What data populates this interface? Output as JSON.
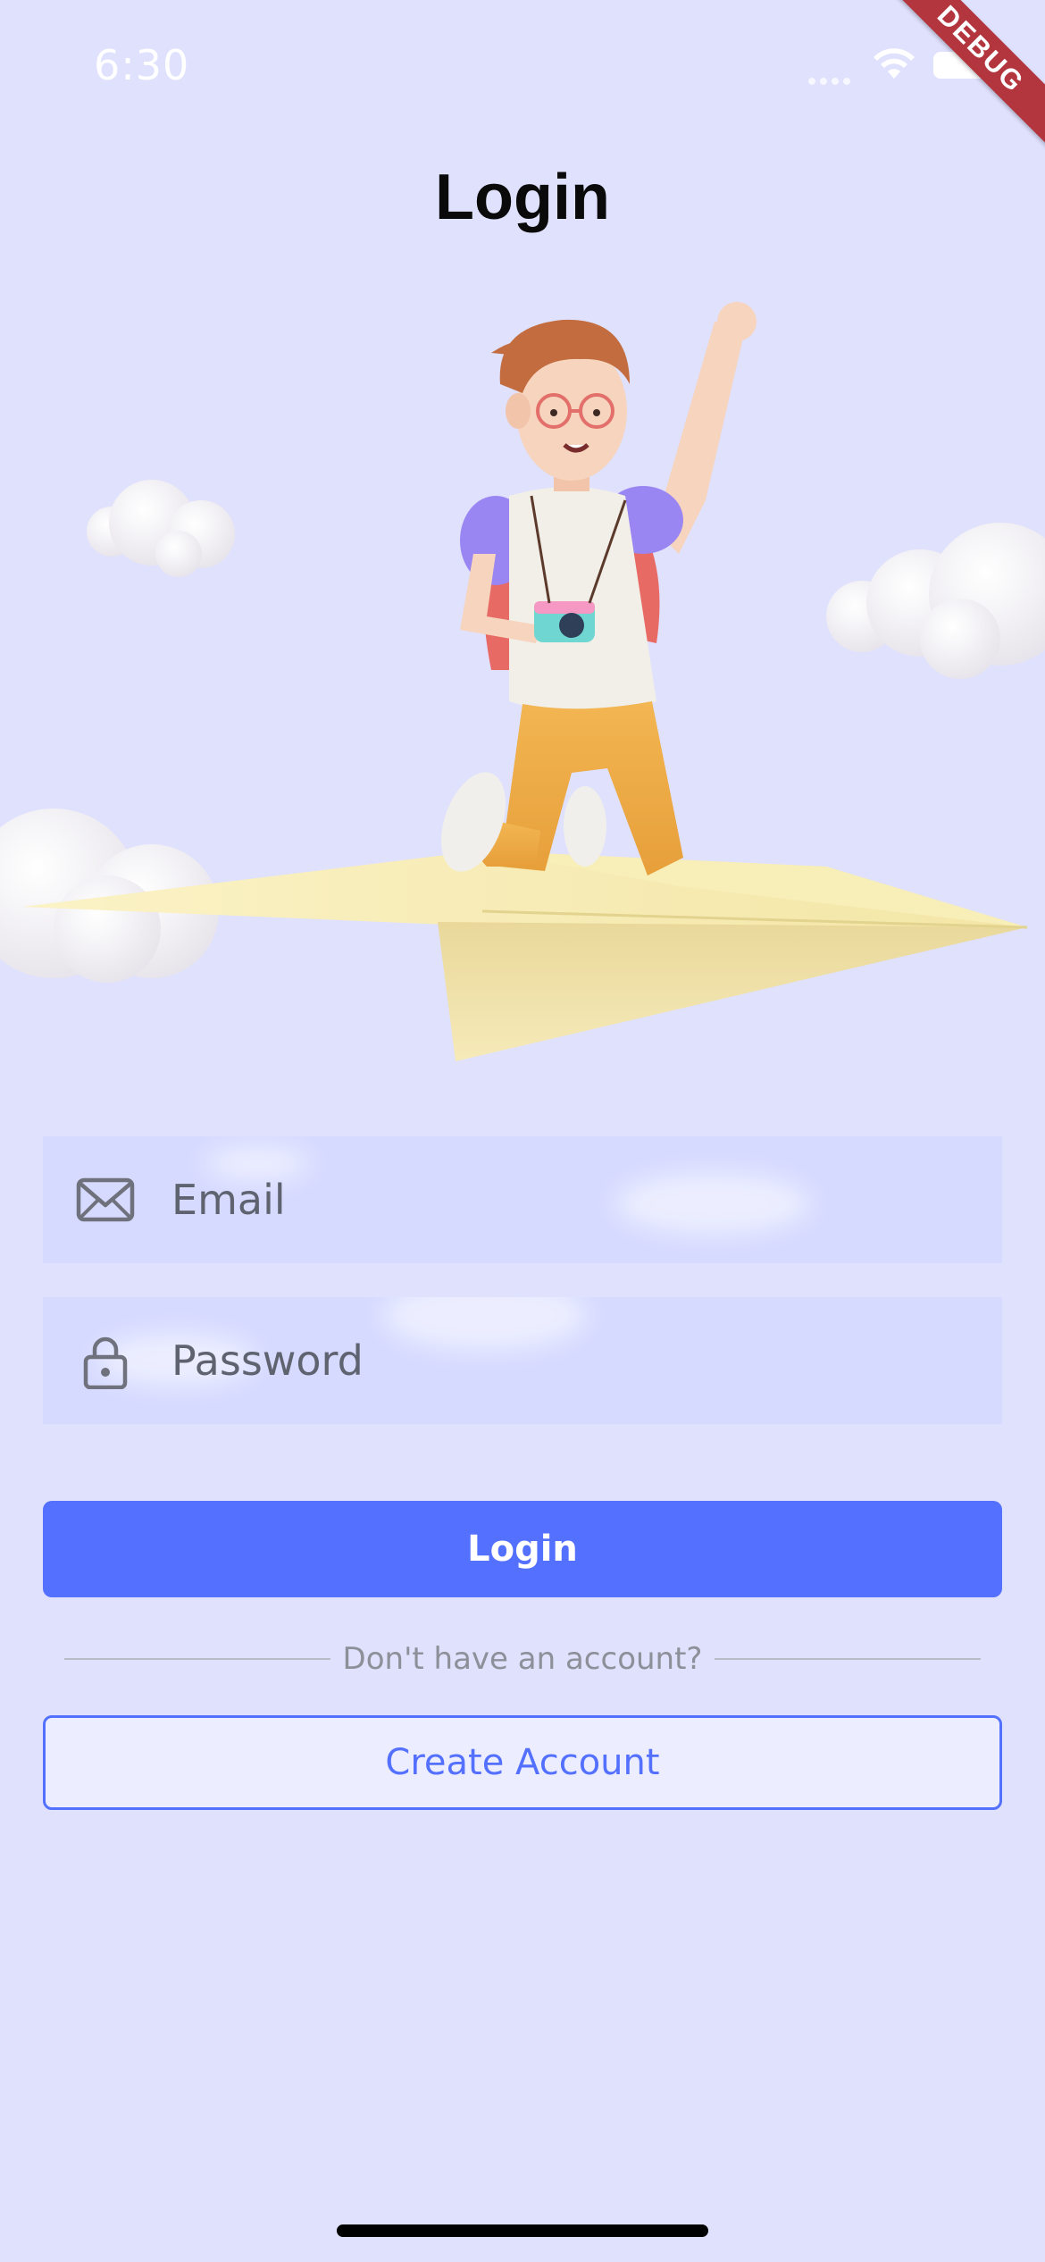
{
  "status_bar": {
    "time": "6:30",
    "wifi_icon": "wifi-icon",
    "battery_icon": "battery-icon"
  },
  "debug_banner": "DEBUG",
  "page": {
    "title": "Login",
    "illustration": "boy-on-paper-plane-illustration"
  },
  "form": {
    "email": {
      "placeholder": "Email",
      "value": "",
      "icon": "envelope-icon"
    },
    "password": {
      "placeholder": "Password",
      "value": "",
      "icon": "lock-icon"
    }
  },
  "actions": {
    "login_label": "Login",
    "divider_text": "Don't have an account?",
    "create_account_label": "Create Account"
  },
  "colors": {
    "background": "#dfe1fd",
    "field_background": "#d6daff",
    "primary": "#5470ff",
    "debug_banner": "#b3363f"
  }
}
